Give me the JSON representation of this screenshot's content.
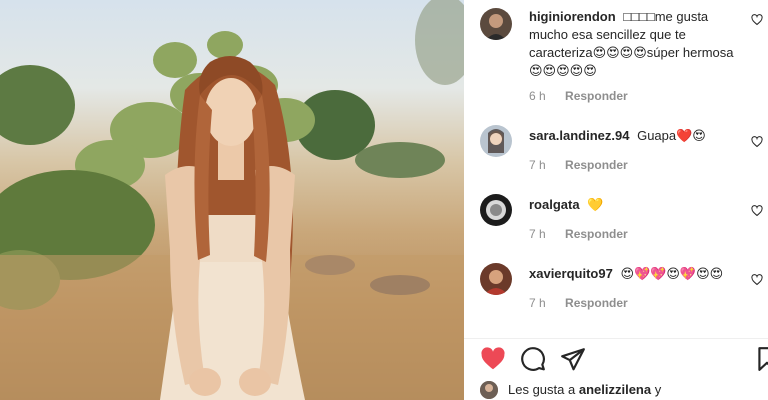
{
  "post": {
    "image_alt": "Foto de una joven con vestido claro en un campo con nopales"
  },
  "comments": [
    {
      "username": "higiniorendon",
      "text": "□□□□me gusta mucho esa sencillez que te caracteriza😍😍😍😍súper hermosa😍😍😍😍😍",
      "time": "6 h",
      "reply_label": "Responder"
    },
    {
      "username": "sara.landinez.94",
      "text": "Guapa❤️😍",
      "time": "7 h",
      "reply_label": "Responder"
    },
    {
      "username": "roalgata",
      "text": "💛",
      "time": "7 h",
      "reply_label": "Responder"
    },
    {
      "username": "xavierquito97",
      "text": "😍💖💖😍💖😍😍",
      "time": "7 h",
      "reply_label": "Responder"
    }
  ],
  "likes": {
    "prefix": "Les gusta a",
    "user": "anelizzilena",
    "suffix": "y"
  },
  "colors": {
    "like_active": "#ed4956",
    "meta_gray": "#8e8e8e",
    "text": "#262626"
  },
  "icons": {
    "like": "heart-filled-icon",
    "comment": "comment-bubble-icon",
    "share": "paper-plane-icon",
    "save": "bookmark-icon",
    "comment_like": "heart-outline-icon"
  }
}
